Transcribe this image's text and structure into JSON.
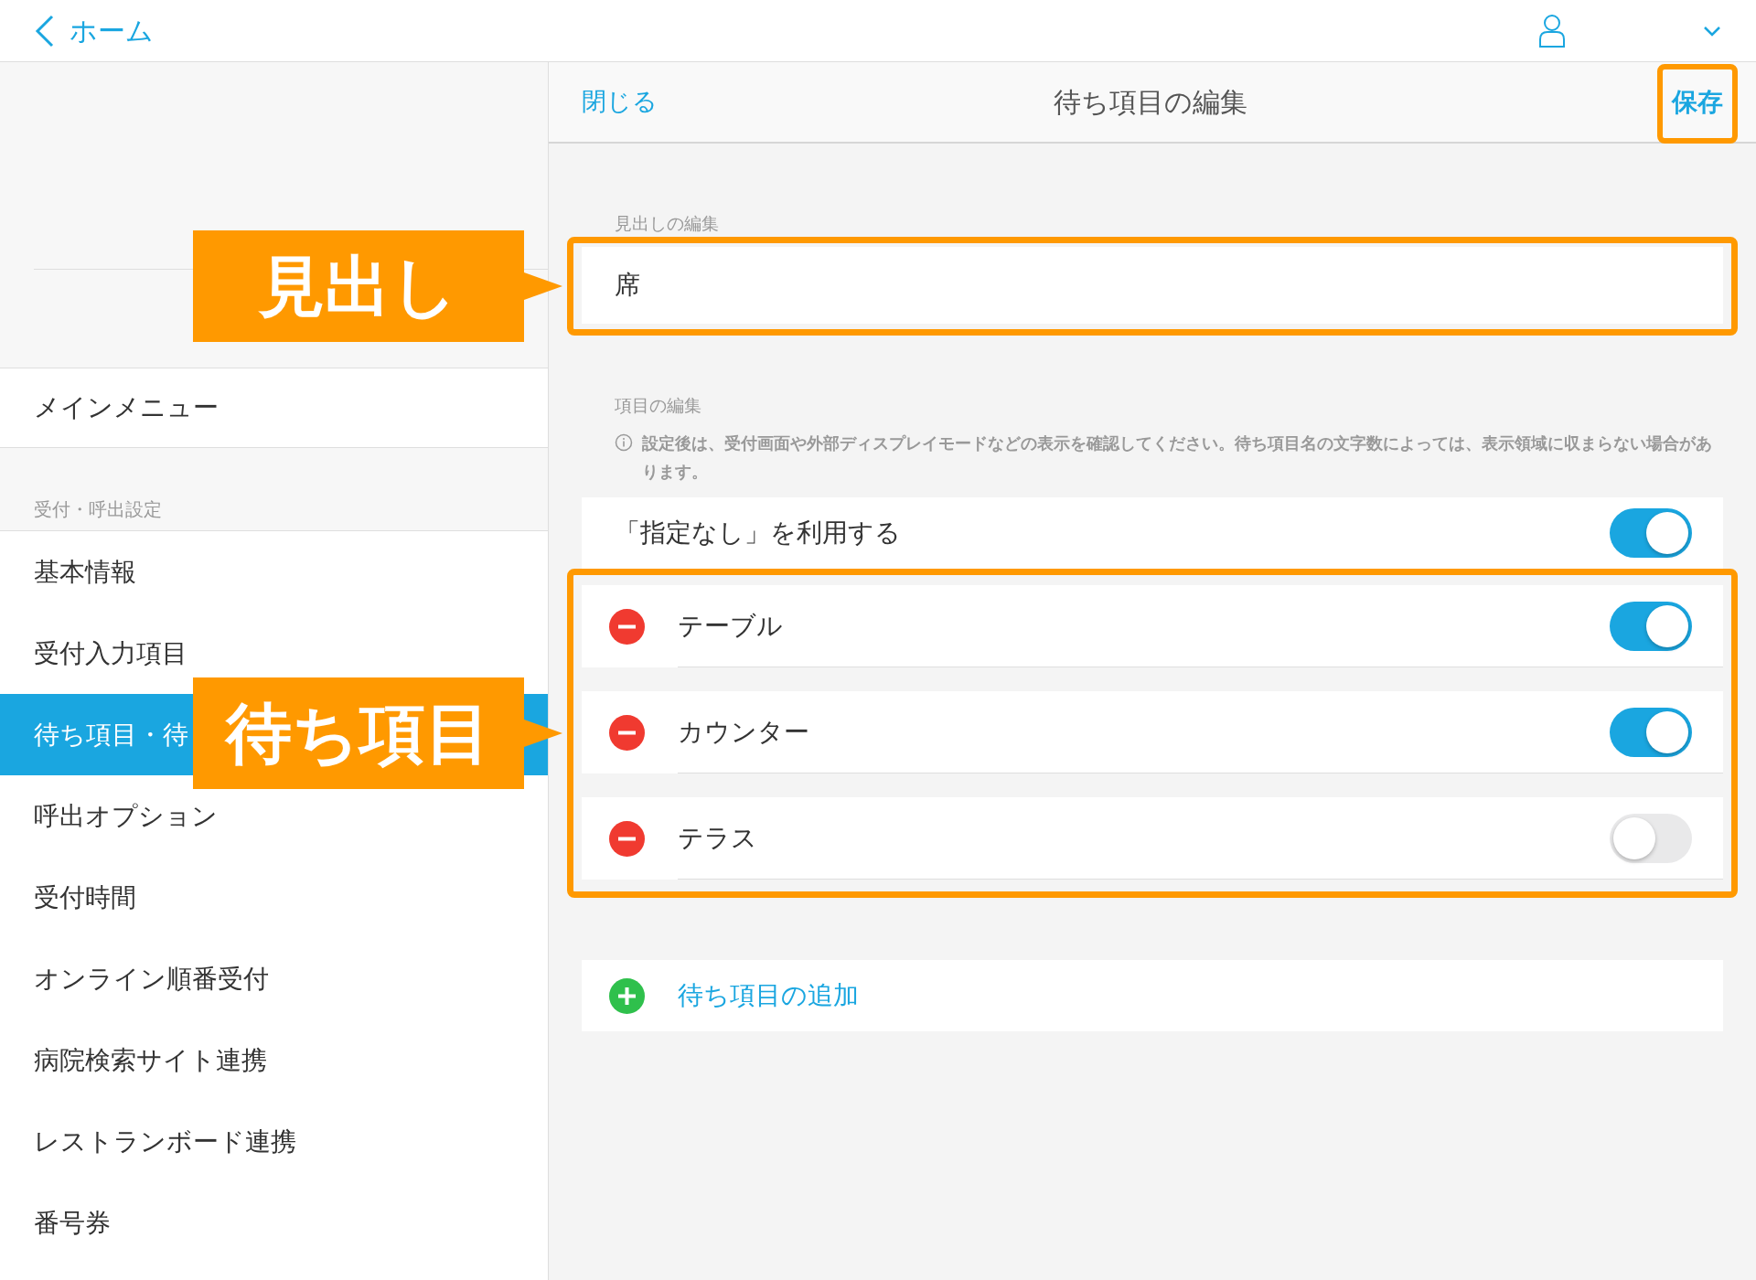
{
  "top_bar": {
    "back_label": "ホーム"
  },
  "sidebar": {
    "main_menu": "メインメニュー",
    "section_label": "受付・呼出設定",
    "items": [
      {
        "label": "基本情報",
        "selected": false
      },
      {
        "label": "受付入力項目",
        "selected": false
      },
      {
        "label": "待ち項目・待",
        "selected": true
      },
      {
        "label": "呼出オプション",
        "selected": false
      },
      {
        "label": "受付時間",
        "selected": false
      },
      {
        "label": "オンライン順番受付",
        "selected": false
      },
      {
        "label": "病院検索サイト連携",
        "selected": false
      },
      {
        "label": "レストランボード連携",
        "selected": false
      },
      {
        "label": "番号券",
        "selected": false
      }
    ]
  },
  "editor": {
    "close_label": "閉じる",
    "title": "待ち項目の編集",
    "save_label": "保存",
    "heading_section": {
      "label": "見出しの編集",
      "value": "席"
    },
    "items_section": {
      "label": "項目の編集",
      "note": "設定後は、受付画面や外部ディスプレイモードなどの表示を確認してください。待ち項目名の文字数によっては、表示領域に収まらない場合があります。"
    },
    "none_option": {
      "label": "「指定なし」を利用する",
      "on": true
    },
    "items": [
      {
        "label": "テーブル",
        "on": true
      },
      {
        "label": "カウンター",
        "on": true
      },
      {
        "label": "テラス",
        "on": false
      }
    ],
    "add_label": "待ち項目の追加"
  },
  "callouts": [
    {
      "text": "見出し"
    },
    {
      "text": "待ち項目"
    }
  ]
}
